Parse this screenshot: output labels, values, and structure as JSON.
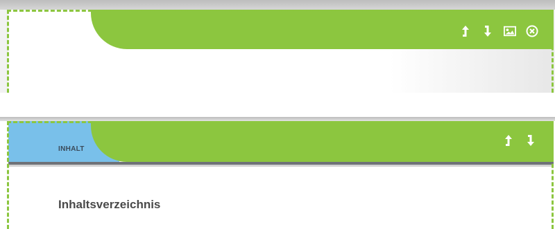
{
  "top_panel": {
    "toolbar": {
      "icons": [
        "arrow-up-icon",
        "arrow-down-icon",
        "image-icon",
        "close-circle-icon"
      ]
    }
  },
  "bottom_panel": {
    "tab_label": "INHALT",
    "section_title": "Inhaltsverzeichnis",
    "toolbar": {
      "icons": [
        "arrow-up-icon",
        "arrow-down-icon"
      ]
    }
  },
  "colors": {
    "accent_green": "#8cc63f",
    "tab_blue": "#79c0ea",
    "separator": "#6f7278",
    "text_dark": "#4a4a4a"
  }
}
